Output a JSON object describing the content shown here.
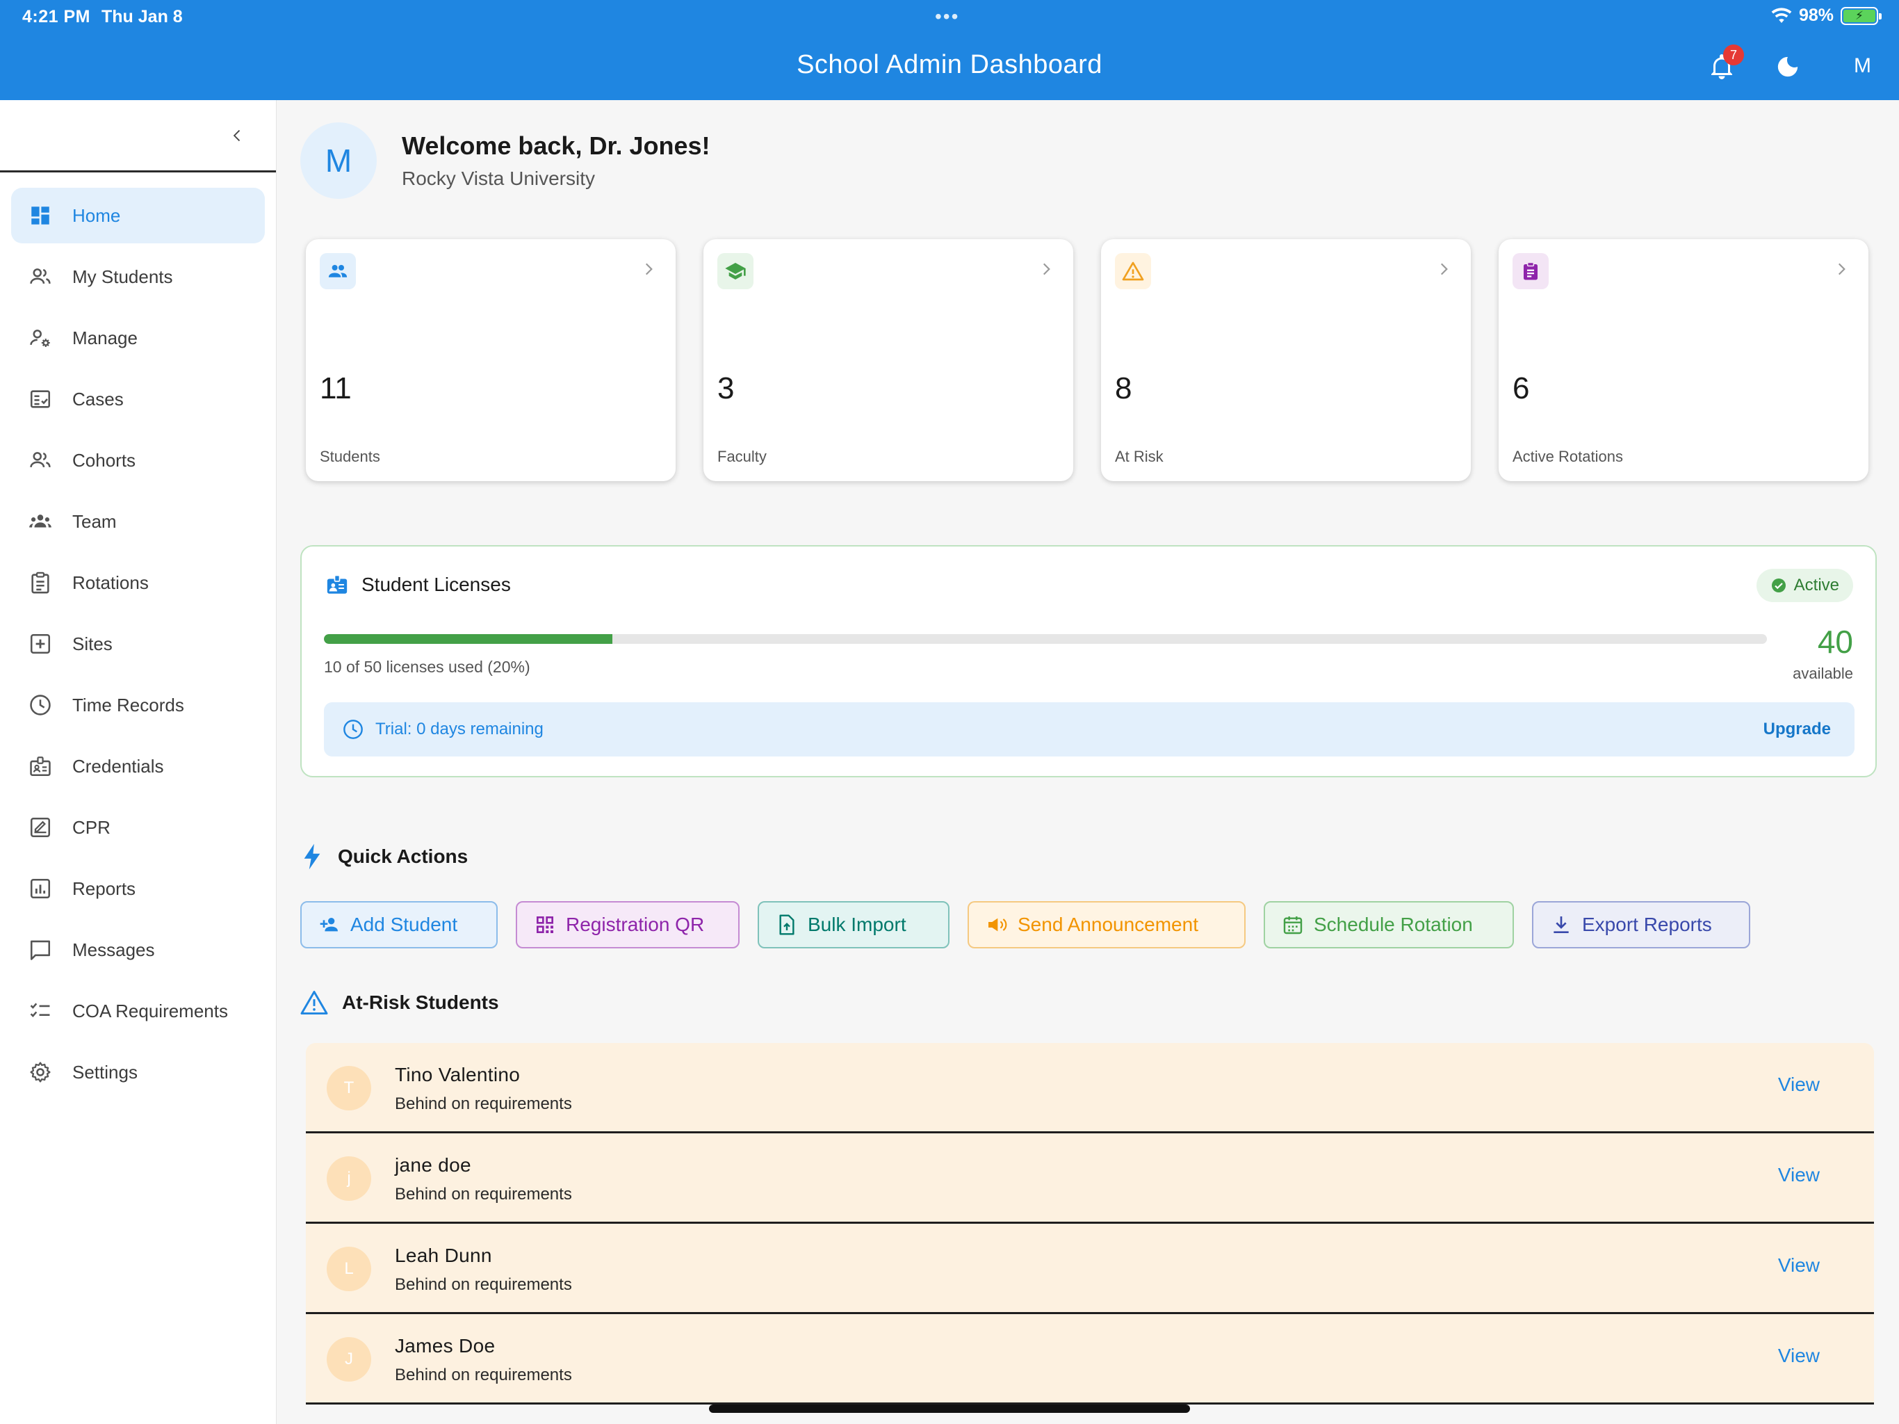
{
  "status_bar": {
    "time": "4:21 PM",
    "date": "Thu Jan 8",
    "dots": "•••",
    "battery": "98%"
  },
  "appbar": {
    "title": "School Admin Dashboard",
    "notification_count": "7",
    "avatar_initial": "M",
    "color": "#1f86e1"
  },
  "sidebar": {
    "items": [
      {
        "label": "Home",
        "icon": "dashboard-icon",
        "active": true
      },
      {
        "label": "My Students",
        "icon": "people-icon"
      },
      {
        "label": "Manage",
        "icon": "manage-accounts-icon"
      },
      {
        "label": "Cases",
        "icon": "fact-check-icon"
      },
      {
        "label": "Cohorts",
        "icon": "group-icon"
      },
      {
        "label": "Team",
        "icon": "groups-icon"
      },
      {
        "label": "Rotations",
        "icon": "clipboard-icon"
      },
      {
        "label": "Sites",
        "icon": "add-box-icon"
      },
      {
        "label": "Time Records",
        "icon": "clock-icon"
      },
      {
        "label": "Credentials",
        "icon": "badge-icon"
      },
      {
        "label": "CPR",
        "icon": "signature-icon"
      },
      {
        "label": "Reports",
        "icon": "bar-chart-icon"
      },
      {
        "label": "Messages",
        "icon": "chat-bubble-icon"
      },
      {
        "label": "COA Requirements",
        "icon": "checklist-icon"
      },
      {
        "label": "Settings",
        "icon": "gear-icon"
      }
    ]
  },
  "welcome": {
    "avatar_initial": "M",
    "title": "Welcome back, Dr. Jones!",
    "subtitle": "Rocky Vista University"
  },
  "stats": [
    {
      "value": "11",
      "label": "Students",
      "icon": "people-icon",
      "color": "#1f86e1",
      "bg": "#e3f0fc"
    },
    {
      "value": "3",
      "label": "Faculty",
      "icon": "school-icon",
      "color": "#43a047",
      "bg": "#e8f5e9"
    },
    {
      "value": "8",
      "label": "At Risk",
      "icon": "warning-icon",
      "color": "#f0a020",
      "bg": "#fff3e0"
    },
    {
      "value": "6",
      "label": "Active Rotations",
      "icon": "assignment-icon",
      "color": "#8e24aa",
      "bg": "#f3e5f5"
    }
  ],
  "licenses": {
    "title": "Student Licenses",
    "status": "Active",
    "used": 10,
    "total": 50,
    "used_text": "10 of 50 licenses used (20%)",
    "available_count": "40",
    "available_label": "available",
    "trial_text": "Trial: 0 days remaining",
    "upgrade_label": "Upgrade"
  },
  "quick_actions": {
    "title": "Quick Actions",
    "buttons": [
      {
        "label": "Add Student",
        "icon": "person-add-icon",
        "color": "#1f86e1",
        "bg": "#e8f2fc"
      },
      {
        "label": "Registration QR",
        "icon": "qr-code-icon",
        "color": "#8e24aa",
        "bg": "#f6e9f8"
      },
      {
        "label": "Bulk Import",
        "icon": "file-upload-icon",
        "color": "#00897b",
        "bg": "#e3f4f2"
      },
      {
        "label": "Send Announcement",
        "icon": "megaphone-icon",
        "color": "#f29400",
        "bg": "#fff4e3"
      },
      {
        "label": "Schedule Rotation",
        "icon": "calendar-icon",
        "color": "#43a047",
        "bg": "#ebf6ec"
      },
      {
        "label": "Export Reports",
        "icon": "download-icon",
        "color": "#3949ab",
        "bg": "#eceef8"
      }
    ]
  },
  "at_risk": {
    "title": "At-Risk Students",
    "students": [
      {
        "initial": "T",
        "name": "Tino Valentino",
        "status": "Behind on requirements",
        "action": "View"
      },
      {
        "initial": "j",
        "name": "jane doe",
        "status": "Behind on requirements",
        "action": "View"
      },
      {
        "initial": "L",
        "name": "Leah Dunn",
        "status": "Behind on requirements",
        "action": "View"
      },
      {
        "initial": "J",
        "name": "James Doe",
        "status": "Behind on requirements",
        "action": "View"
      }
    ]
  }
}
